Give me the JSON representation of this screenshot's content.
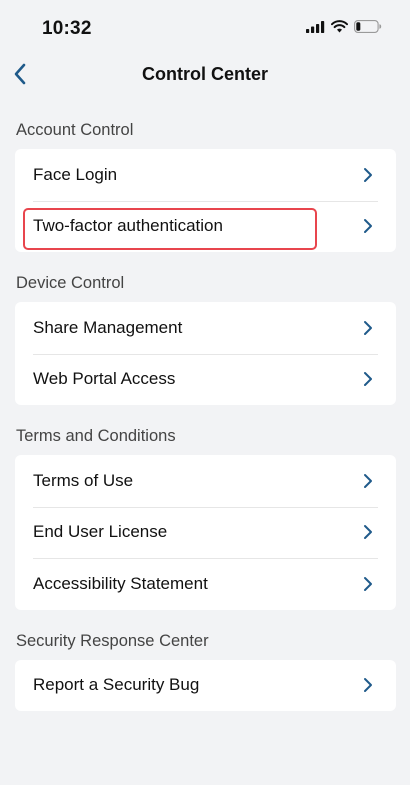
{
  "status_bar": {
    "time": "10:32"
  },
  "header": {
    "title": "Control Center"
  },
  "sections": [
    {
      "title": "Account Control",
      "items": [
        {
          "label": "Face Login"
        },
        {
          "label": "Two-factor authentication"
        }
      ]
    },
    {
      "title": "Device Control",
      "items": [
        {
          "label": "Share Management"
        },
        {
          "label": "Web Portal Access"
        }
      ]
    },
    {
      "title": "Terms and Conditions",
      "items": [
        {
          "label": "Terms of Use"
        },
        {
          "label": "End User License"
        },
        {
          "label": "Accessibility Statement"
        }
      ]
    },
    {
      "title": "Security Response Center",
      "items": [
        {
          "label": "Report a Security Bug"
        }
      ]
    }
  ],
  "colors": {
    "background": "#f2f3f5",
    "card": "#ffffff",
    "accent": "#1f5a8a",
    "highlight": "#e8454d"
  },
  "icons": {
    "back": "chevron-left-icon",
    "row": "chevron-right-icon",
    "signal": "cellular-signal-icon",
    "wifi": "wifi-icon",
    "battery": "battery-icon"
  },
  "battery_level": 0.2
}
